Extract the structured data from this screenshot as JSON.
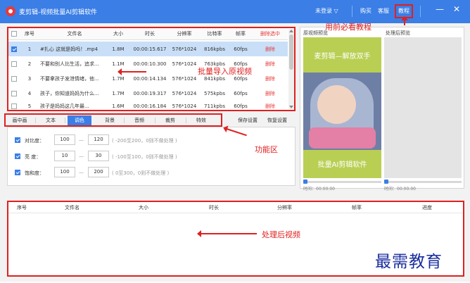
{
  "titlebar": {
    "title": "麦剪辑-视频批量AI剪辑软件",
    "login": "未登录 ▽",
    "buy": "购买",
    "service": "客服",
    "help": "教程"
  },
  "file_table": {
    "columns": [
      "序号",
      "文件名",
      "大小",
      "时长",
      "分辨率",
      "比特率",
      "帧率",
      "删除选中"
    ],
    "rows": [
      {
        "no": "1",
        "name": "#扎心 这就是妈吗！.mp4",
        "size": "1.8M",
        "duration": "00:00:15.617",
        "resolution": "576*1024",
        "bitrate": "816kpbs",
        "fps": "60fps",
        "del": "删除",
        "checked": true
      },
      {
        "no": "2",
        "name": "不要和别人比生活，追求...",
        "size": "1.1M",
        "duration": "00:00:10.300",
        "resolution": "576*1024",
        "bitrate": "763kpbs",
        "fps": "60fps",
        "del": "删除",
        "checked": false
      },
      {
        "no": "3",
        "name": "不要拿孩子发泄情绪，他...",
        "size": "1.7M",
        "duration": "00:00:14.134",
        "resolution": "576*1024",
        "bitrate": "841kpbs",
        "fps": "60fps",
        "del": "删除",
        "checked": false
      },
      {
        "no": "4",
        "name": "孩子，你知道妈妈为什么...",
        "size": "1.7M",
        "duration": "00:00:19.317",
        "resolution": "576*1024",
        "bitrate": "575kpbs",
        "fps": "60fps",
        "del": "删除",
        "checked": false
      },
      {
        "no": "5",
        "name": "孩子是妈妈这几年最...",
        "size": "1.6M",
        "duration": "00:00:16.184",
        "resolution": "576*1024",
        "bitrate": "711kpbs",
        "fps": "60fps",
        "del": "删除",
        "checked": false
      }
    ]
  },
  "preview": {
    "original_label": "原视频预览",
    "processed_label": "处理后预览",
    "overlay_top": "麦剪辑—解放双手",
    "overlay_bottom": "批量AI剪辑软件",
    "time_left": "时间：00:00:00",
    "time_right": "时间：00:00:00"
  },
  "tabs": {
    "items": [
      "画中画",
      "文本",
      "调色",
      "背景",
      "音频",
      "裁剪",
      "特效"
    ],
    "active_index": 2,
    "save_settings": "保存设置",
    "restore_settings": "恢复设置"
  },
  "color_params": [
    {
      "label": "对比度：",
      "min": "100",
      "max": "120",
      "hint": "( -200至200，0则不做处理 )",
      "checked": true
    },
    {
      "label": "亮  度：",
      "min": "10",
      "max": "30",
      "hint": "( -100至100，0则不做处理 )",
      "checked": true
    },
    {
      "label": "饱和度：",
      "min": "100",
      "max": "200",
      "hint": "( 0至300，0则不做处理 )",
      "checked": true
    }
  ],
  "param_separator": "—",
  "output_table": {
    "columns": [
      "序号",
      "文件名",
      "大小",
      "时长",
      "分辨率",
      "帧率",
      "进度"
    ]
  },
  "annotations": {
    "import": "批量导入原视频",
    "tutorial": "用前必看教程",
    "function": "功能区",
    "processed": "处理后视频"
  },
  "watermark": "最需教育",
  "colors": {
    "titlebar": "#3a7ee6",
    "accent": "#3a7ee6",
    "annotation": "#e02020",
    "delete": "#e83a3a",
    "watermark": "#1a2d9e"
  },
  "icons": {
    "logo": "app-logo-icon",
    "minimize": "minimize-icon",
    "close": "close-icon"
  }
}
